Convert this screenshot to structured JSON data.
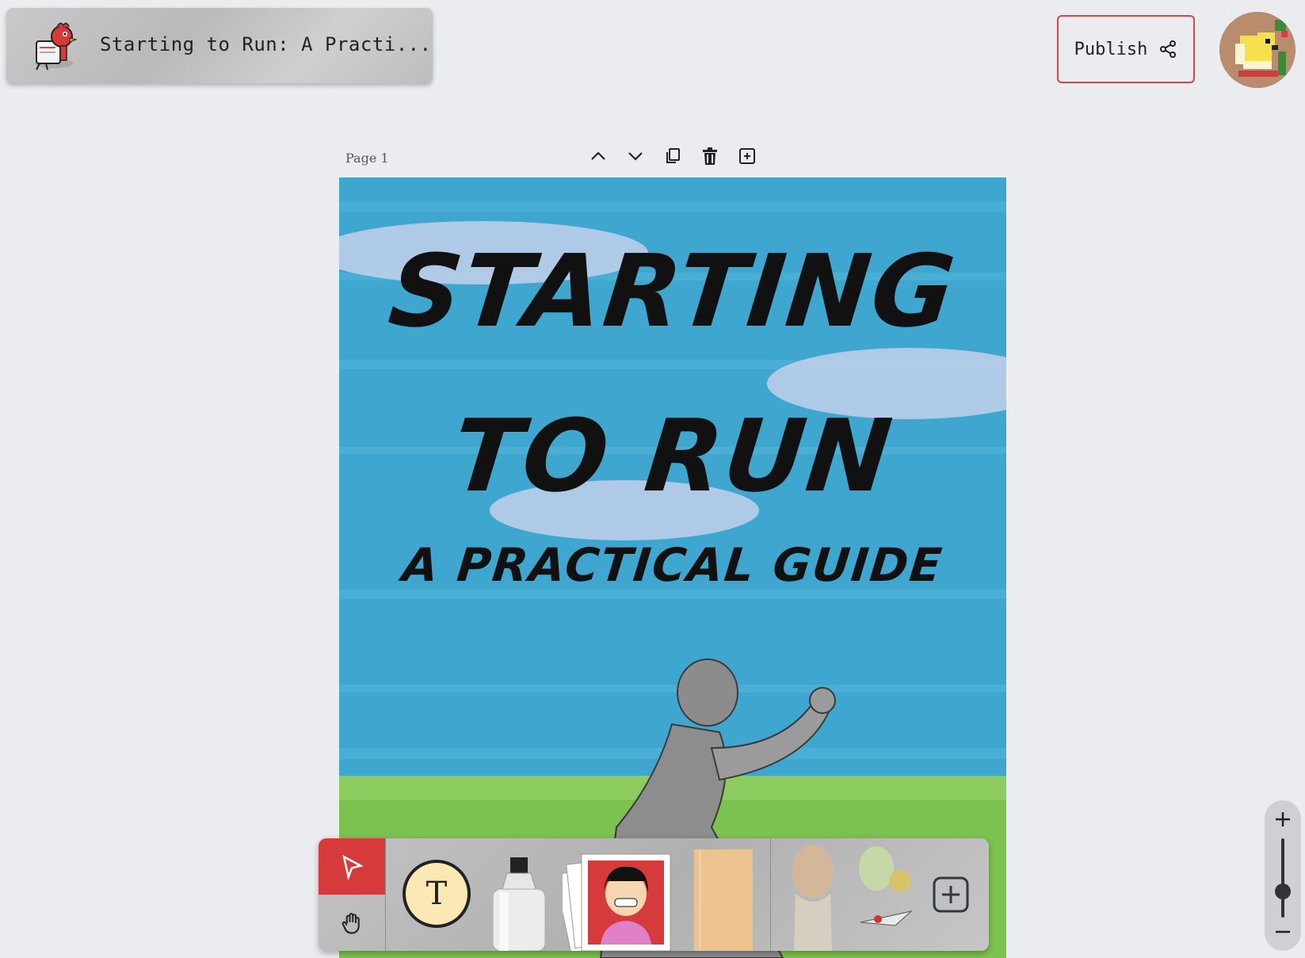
{
  "header": {
    "document_title": "Starting to Run: A Practi...",
    "publish_label": "Publish"
  },
  "page_controls": {
    "page_label": "Page 1"
  },
  "cover": {
    "title_line1": "STARTING",
    "title_line2": "TO RUN",
    "subtitle": "A PRACTICAL GUIDE"
  },
  "toolbar": {
    "text_tool_label": "T"
  },
  "colors": {
    "accent_red": "#d63a3a",
    "sky_blue": "#3fa6cf",
    "grass_green": "#7cc24e",
    "background": "#ebecf0"
  }
}
